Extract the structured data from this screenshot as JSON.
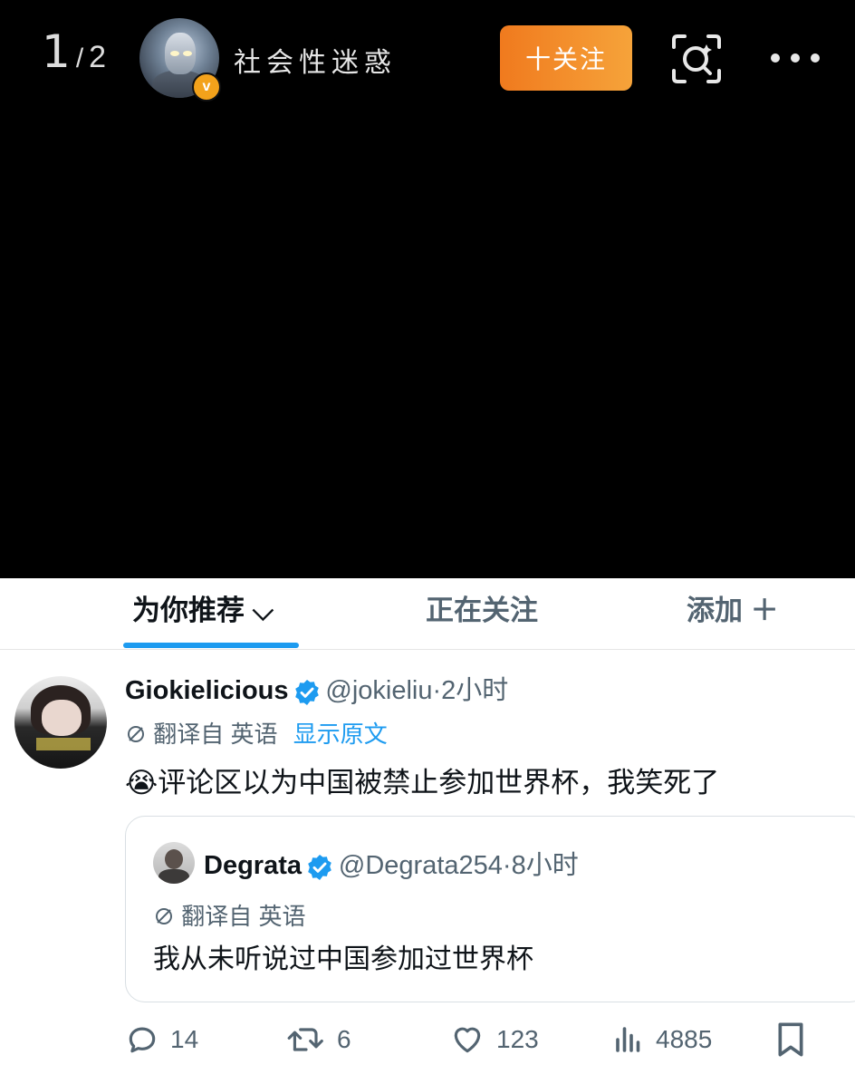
{
  "viewer": {
    "page_current": "1",
    "page_separator": "/",
    "page_total": "2",
    "username": "社会性迷惑",
    "verified_badge": "v",
    "follow_label": "十关注",
    "icons": [
      "lens-icon",
      "more-icon"
    ]
  },
  "tweet_screenshot": {
    "tabs": [
      {
        "label": "为你推荐 ⌵",
        "selected": true
      },
      {
        "label": "正在关注",
        "selected": false
      },
      {
        "label": "添加 ＋",
        "selected": false
      }
    ],
    "accent_color": "#1d9bf0",
    "post": {
      "name": "Giokielicious",
      "handle": "@jokieliu",
      "time": "·2小时",
      "translated_from": "翻译自 英语",
      "show_original": "显示原文",
      "emoji": "😭",
      "text": "评论区以为中国被禁止参加世界杯，我笑死了"
    },
    "quoted": {
      "name": "Degrata",
      "handle": "@Degrata254",
      "time": "·8小时",
      "translated_from": "翻译自 英语",
      "text": "我从未听说过中国参加过世界杯"
    },
    "actions": {
      "replies": "14",
      "reposts": "6",
      "likes": "123",
      "views": "4885"
    }
  }
}
